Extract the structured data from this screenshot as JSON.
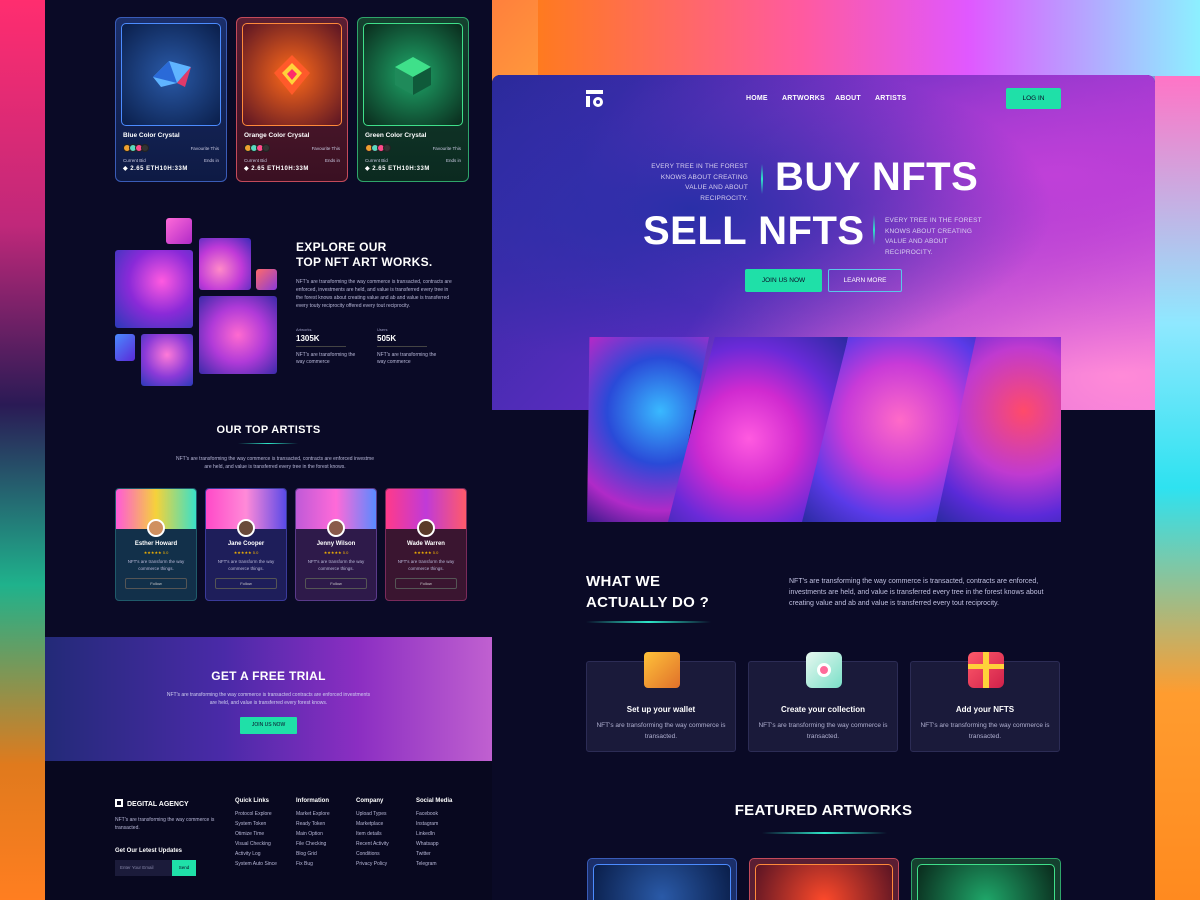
{
  "left_page": {
    "cards": [
      {
        "name": "Blue Color Crystal",
        "fav": "Favourite This",
        "bid_label": "Current Bid",
        "bid": "2.65 ETH",
        "ends_label": "Ends in",
        "ends": "10H:33M",
        "accent": "#3a5cb8"
      },
      {
        "name": "Orange Color Crystal",
        "fav": "Favourite This",
        "bid_label": "Current Bid",
        "bid": "2.65 ETH",
        "ends_label": "Ends in",
        "ends": "10H:33M",
        "accent": "#c44a5a"
      },
      {
        "name": "Green Color Crystal",
        "fav": "Favourite This",
        "bid_label": "Current Bid",
        "bid": "2.65 ETH",
        "ends_label": "Ends in",
        "ends": "10H:33M",
        "accent": "#2fa56a"
      }
    ],
    "explore": {
      "heading_line1": "EXPLORE OUR",
      "heading_line2": "TOP NFT ART WORKS.",
      "paragraph": "NFT's are transforming the way commerce is transacted, contracts are enforced, investments are held, and value is transferred every tree in the forest knows about creating value and ab and value is transferred every touty reciprocity offered every tout reciprocity.",
      "stats": [
        {
          "label": "Artworks",
          "value": "1305K",
          "desc": "NFT's are transforming the way commerce"
        },
        {
          "label": "Users",
          "value": "505K",
          "desc": "NFT's are transforming the way commerce"
        }
      ]
    },
    "artists": {
      "heading": "OUR TOP ARTISTS",
      "paragraph": "NFT's are transforming the way commerce is transacted, contracts are enforced investme are held, and value is transferred every tree in the forest knows.",
      "items": [
        {
          "name": "Esther Howard",
          "rating": "★★★★★ 5.0",
          "desc": "NFT's are transform the way commerce things.",
          "button": "Follow"
        },
        {
          "name": "Jane Cooper",
          "rating": "★★★★★ 5.0",
          "desc": "NFT's are transform the way commerce things.",
          "button": "Follow"
        },
        {
          "name": "Jenny Wilson",
          "rating": "★★★★★ 5.0",
          "desc": "NFT's are transform the way commerce things.",
          "button": "Follow"
        },
        {
          "name": "Wade Warren",
          "rating": "★★★★★ 5.0",
          "desc": "NFT's are transform the way commerce things.",
          "button": "Follow"
        }
      ]
    },
    "trial": {
      "heading": "GET A FREE TRIAL",
      "paragraph": "NFT's are transforming the way commerce is transacted contracts are enforced investments are held, and value is transferred every forest knows.",
      "button": "JOIN US NOW"
    },
    "footer": {
      "brand": "DEGITAL AGENCY",
      "desc": "NFT's are transforming the way commerce is transacted.",
      "updates": "Get Our Letest Updates",
      "input_placeholder": "Enter Your Email",
      "send": "Send",
      "columns": [
        {
          "title": "Quick Links",
          "links": [
            "Protocol Explore",
            "System Token",
            "Otimize Time",
            "Visual Checking",
            "Activity Log",
            "System Auto Since"
          ]
        },
        {
          "title": "Information",
          "links": [
            "Market Explore",
            "Ready Token",
            "Main Option",
            "File Checking",
            "Blog Grid",
            "Fix Bug"
          ]
        },
        {
          "title": "Company",
          "links": [
            "Upload Types",
            "Marketplace",
            "Item details",
            "Recent Activity",
            "Conditions",
            "Privacy Policy"
          ]
        },
        {
          "title": "Social Media",
          "links": [
            "Facebook",
            "Instagram",
            "LinkedIn",
            "Whatsapp",
            "Twitter",
            "Telegram"
          ]
        }
      ]
    }
  },
  "right_page": {
    "nav": {
      "home": "HOME",
      "artworks": "ARTWORKS",
      "about": "ABOUT",
      "artists": "ARTISTS",
      "login": "LOG IN"
    },
    "hero": {
      "tagline1": "EVERY TREE IN THE FOREST KNOWS ABOUT CREATING VALUE AND ABOUT RECIPROCITY.",
      "tagline2": "EVERY TREE IN THE FOREST KNOWS ABOUT CREATING VALUE AND ABOUT RECIPROCITY.",
      "buy": "BUY NFTS",
      "sell": "SELL NFTS",
      "join": "JOIN US NOW",
      "learn": "LEARN MORE"
    },
    "what_we_do": {
      "heading_line1": "WHAT WE",
      "heading_line2": "ACTUALLY DO ?",
      "paragraph": "NFT's are transforming the way commerce is transacted, contracts are enforced, investments are held, and value is transferred every tree in the forest knows about creating value and ab and value is transferred every tout reciprocity."
    },
    "features": [
      {
        "title": "Set up your wallet",
        "desc": "NFT's are transforming the way commerce is transacted.",
        "icon": "wallet-icon",
        "color": "#f0a030"
      },
      {
        "title": "Create your collection",
        "desc": "NFT's are transforming the way commerce is transacted.",
        "icon": "camera-icon",
        "color": "#5ad8c0"
      },
      {
        "title": "Add your NFTS",
        "desc": "NFT's are transforming the way commerce is transacted.",
        "icon": "gift-icon",
        "color": "#ff4a5a"
      }
    ],
    "featured_heading": "FEATURED ARTWORKS"
  }
}
